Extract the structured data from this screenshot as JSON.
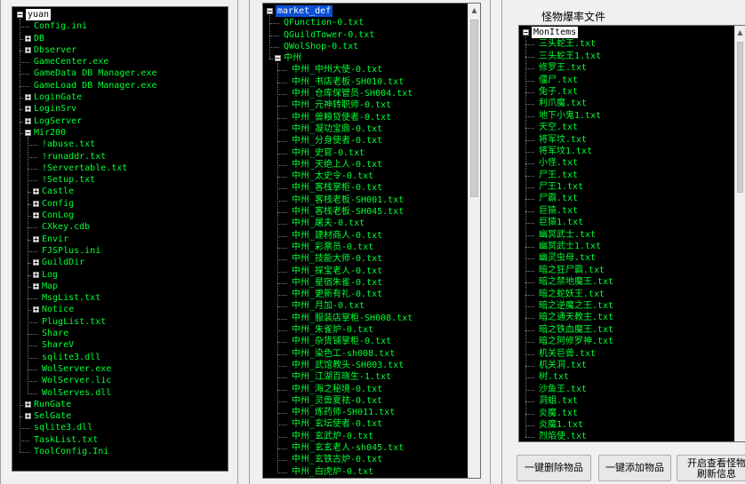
{
  "left_tree": {
    "nodes": [
      {
        "level": 0,
        "label": "yuan",
        "toggle": "-",
        "style": "rootsel"
      },
      {
        "level": 1,
        "label": "Config.ini"
      },
      {
        "level": 1,
        "label": "DB",
        "toggle": "+"
      },
      {
        "level": 1,
        "label": "Dbserver",
        "toggle": "+"
      },
      {
        "level": 1,
        "label": "GameCenter.exe"
      },
      {
        "level": 1,
        "label": "GameData DB Manager.exe"
      },
      {
        "level": 1,
        "label": "GameLoad DB Manager.exe"
      },
      {
        "level": 1,
        "label": "LoginGate",
        "toggle": "+"
      },
      {
        "level": 1,
        "label": "LoginSrv",
        "toggle": "+"
      },
      {
        "level": 1,
        "label": "LogServer",
        "toggle": "+"
      },
      {
        "level": 1,
        "label": "Mir200",
        "toggle": "-"
      },
      {
        "level": 2,
        "label": "!abuse.txt"
      },
      {
        "level": 2,
        "label": "!runaddr.txt"
      },
      {
        "level": 2,
        "label": "!Servertable.txt"
      },
      {
        "level": 2,
        "label": "!Setup.txt"
      },
      {
        "level": 2,
        "label": "Castle",
        "toggle": "+"
      },
      {
        "level": 2,
        "label": "Config",
        "toggle": "+"
      },
      {
        "level": 2,
        "label": "ConLog",
        "toggle": "+"
      },
      {
        "level": 2,
        "label": "CXkey.cdb"
      },
      {
        "level": 2,
        "label": "Envir",
        "toggle": "+"
      },
      {
        "level": 2,
        "label": "FJSPlus.ini"
      },
      {
        "level": 2,
        "label": "GuildDir",
        "toggle": "+"
      },
      {
        "level": 2,
        "label": "Log",
        "toggle": "+"
      },
      {
        "level": 2,
        "label": "Map",
        "toggle": "+"
      },
      {
        "level": 2,
        "label": "MsgList.txt"
      },
      {
        "level": 2,
        "label": "Notice",
        "toggle": "+"
      },
      {
        "level": 2,
        "label": "PlugList.txt"
      },
      {
        "level": 2,
        "label": "Share"
      },
      {
        "level": 2,
        "label": "ShareV"
      },
      {
        "level": 2,
        "label": "sqlite3.dll"
      },
      {
        "level": 2,
        "label": "WolServer.exe"
      },
      {
        "level": 2,
        "label": "WolServer.lic"
      },
      {
        "level": 2,
        "label": "WolServes.dll"
      },
      {
        "level": 1,
        "label": "RunGate",
        "toggle": "+"
      },
      {
        "level": 1,
        "label": "SelGate",
        "toggle": "+"
      },
      {
        "level": 1,
        "label": "sqlite3.dll"
      },
      {
        "level": 1,
        "label": "TaskList.txt"
      },
      {
        "level": 1,
        "label": "ToolConfig.Ini"
      }
    ]
  },
  "middle_tree": {
    "nodes": [
      {
        "level": 0,
        "label": "market_def",
        "toggle": "-",
        "style": "hl"
      },
      {
        "level": 1,
        "label": "QFunction-0.txt"
      },
      {
        "level": 1,
        "label": "QGuildTower-0.txt"
      },
      {
        "level": 1,
        "label": "QWolShop-0.txt"
      },
      {
        "level": 1,
        "label": "中州",
        "toggle": "-"
      },
      {
        "level": 2,
        "label": "中州_中州大使-0.txt"
      },
      {
        "level": 2,
        "label": "中州_书店老板-SH010.txt"
      },
      {
        "level": 2,
        "label": "中州_仓库保管员-SH004.txt"
      },
      {
        "level": 2,
        "label": "中州_元神转职师-0.txt"
      },
      {
        "level": 2,
        "label": "中州_兽粮贷使者-0.txt"
      },
      {
        "level": 2,
        "label": "中州_凝功宝鼎-0.txt"
      },
      {
        "level": 2,
        "label": "中州_分身使者-0.txt"
      },
      {
        "level": 2,
        "label": "中州_史官-0.txt"
      },
      {
        "level": 2,
        "label": "中州_天绝上人-0.txt"
      },
      {
        "level": 2,
        "label": "中州_太史令-0.txt"
      },
      {
        "level": 2,
        "label": "中州_客栈掌柜-0.txt"
      },
      {
        "level": 2,
        "label": "中州_客栈老板-SH001.txt"
      },
      {
        "level": 2,
        "label": "中州_客栈老板-SH045.txt"
      },
      {
        "level": 2,
        "label": "中州_屠夫-0.txt"
      },
      {
        "level": 2,
        "label": "中州_建材商人-0.txt"
      },
      {
        "level": 2,
        "label": "中州_彩票员-0.txt"
      },
      {
        "level": 2,
        "label": "中州_技能大师-0.txt"
      },
      {
        "level": 2,
        "label": "中州_探宝老人-0.txt"
      },
      {
        "level": 2,
        "label": "中州_星宿朱雀-0.txt"
      },
      {
        "level": 2,
        "label": "中州_更新有礼-0.txt"
      },
      {
        "level": 2,
        "label": "中州_月加-0.txt"
      },
      {
        "level": 2,
        "label": "中州_服装店掌柜-SH008.txt"
      },
      {
        "level": 2,
        "label": "中州_朱雀炉-0.txt"
      },
      {
        "level": 2,
        "label": "中州_杂货铺掌柜-0.txt"
      },
      {
        "level": 2,
        "label": "中州_染色工-sh008.txt"
      },
      {
        "level": 2,
        "label": "中州_武馆教头-SH003.txt"
      },
      {
        "level": 2,
        "label": "中州_江湖百晓生-1.txt"
      },
      {
        "level": 2,
        "label": "中州_海之秘境-0.txt"
      },
      {
        "level": 2,
        "label": "中州_灵兽夏祛-0.txt"
      },
      {
        "level": 2,
        "label": "中州_炼药师-SH011.txt"
      },
      {
        "level": 2,
        "label": "中州_玄坛使者-0.txt"
      },
      {
        "level": 2,
        "label": "中州_玄武炉-0.txt"
      },
      {
        "level": 2,
        "label": "中州_玄玄老人-sh045.txt"
      },
      {
        "level": 2,
        "label": "中州_玄铁古炉-0.txt"
      },
      {
        "level": 2,
        "label": "中州_白虎炉-0.txt"
      }
    ]
  },
  "right_panel": {
    "title": "怪物爆率文件",
    "nodes": [
      {
        "level": 0,
        "label": "MonItems",
        "toggle": "-",
        "style": "rootsel"
      },
      {
        "level": 1,
        "label": "三头蛇王.txt"
      },
      {
        "level": 1,
        "label": "三头蛇王1.txt"
      },
      {
        "level": 1,
        "label": "修罗王.txt"
      },
      {
        "level": 1,
        "label": "僵尸.txt"
      },
      {
        "level": 1,
        "label": "兔子.txt"
      },
      {
        "level": 1,
        "label": "利爪魔.txt"
      },
      {
        "level": 1,
        "label": "地下小鬼1.txt"
      },
      {
        "level": 1,
        "label": "天空.txt"
      },
      {
        "level": 1,
        "label": "将军坟.txt"
      },
      {
        "level": 1,
        "label": "将军坟1.txt"
      },
      {
        "level": 1,
        "label": "小怪.txt"
      },
      {
        "level": 1,
        "label": "尸王.txt"
      },
      {
        "level": 1,
        "label": "尸王1.txt"
      },
      {
        "level": 1,
        "label": "尸霸.txt"
      },
      {
        "level": 1,
        "label": "巨猿.txt"
      },
      {
        "level": 1,
        "label": "巨猿1.txt"
      },
      {
        "level": 1,
        "label": "幽冥武士.txt"
      },
      {
        "level": 1,
        "label": "幽冥武士1.txt"
      },
      {
        "level": 1,
        "label": "幽灵虫母.txt"
      },
      {
        "level": 1,
        "label": "暗之狂尸霸.txt"
      },
      {
        "level": 1,
        "label": "暗之禁地魔王.txt"
      },
      {
        "level": 1,
        "label": "暗之蛇妖王.txt"
      },
      {
        "level": 1,
        "label": "暗之逆魔之王.txt"
      },
      {
        "level": 1,
        "label": "暗之通天教主.txt"
      },
      {
        "level": 1,
        "label": "暗之铁血魔王.txt"
      },
      {
        "level": 1,
        "label": "暗之阿修罗神.txt"
      },
      {
        "level": 1,
        "label": "机关巨兽.txt"
      },
      {
        "level": 1,
        "label": "机关洞.txt"
      },
      {
        "level": 1,
        "label": "树.txt"
      },
      {
        "level": 1,
        "label": "沙鱼王.txt"
      },
      {
        "level": 1,
        "label": "洞蛆.txt"
      },
      {
        "level": 1,
        "label": "炎魔.txt"
      },
      {
        "level": 1,
        "label": "炎魔1.txt"
      },
      {
        "level": 1,
        "label": "烈焰使.txt"
      }
    ],
    "buttons": {
      "delete_all": "一键删除物品",
      "add_all": "一键添加物品",
      "open_view_line1": "开启查看怪物",
      "open_view_line2": "刷新信息"
    }
  }
}
